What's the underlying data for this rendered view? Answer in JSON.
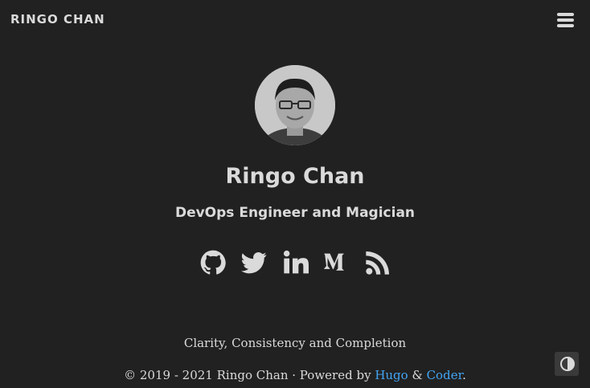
{
  "header": {
    "brand": "RINGO CHAN",
    "menu_icon": "hamburger-icon"
  },
  "profile": {
    "avatar_alt": "Ringo Chan avatar",
    "name": "Ringo Chan",
    "tagline": "DevOps Engineer and Magician"
  },
  "social": [
    {
      "name": "github-icon",
      "label": "GitHub"
    },
    {
      "name": "twitter-icon",
      "label": "Twitter"
    },
    {
      "name": "linkedin-icon",
      "label": "LinkedIn"
    },
    {
      "name": "medium-icon",
      "label": "Medium"
    },
    {
      "name": "rss-icon",
      "label": "RSS"
    }
  ],
  "motto": "Clarity, Consistency and Completion",
  "footer": {
    "copyright": "© 2019 - 2021 Ringo Chan · Powered by ",
    "hugo_label": "Hugo",
    "amp": " & ",
    "coder_label": "Coder",
    "period": "."
  },
  "theme_toggle_icon": "contrast-icon",
  "colors": {
    "background": "#212121",
    "text": "#dadada",
    "link": "#42a5f5"
  }
}
